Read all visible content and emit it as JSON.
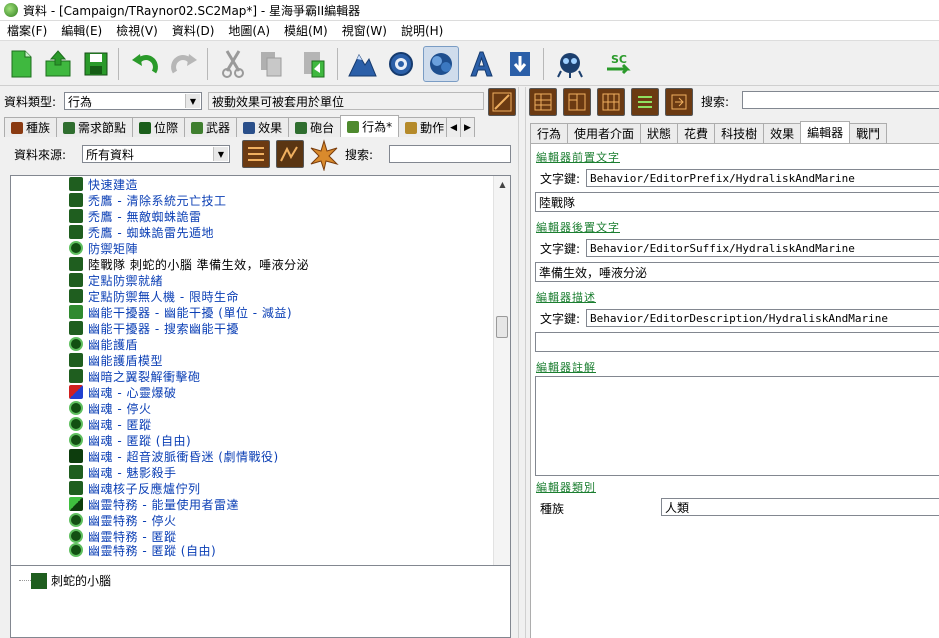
{
  "window": {
    "title": "資料 - [Campaign/TRaynor02.SC2Map*] - 星海爭霸II編輯器"
  },
  "menu": [
    "檔案(F)",
    "編輯(E)",
    "檢視(V)",
    "資料(D)",
    "地圖(A)",
    "模組(M)",
    "視窗(W)",
    "說明(H)"
  ],
  "toolbar": {
    "buttons": [
      "new-file",
      "open-file",
      "save",
      "undo",
      "redo",
      "cut",
      "copy",
      "paste",
      "terrain-editor",
      "trigger-editor",
      "data-editor",
      "text-editor",
      "import-editor",
      "cutscene-editor",
      "script-editor"
    ],
    "pressed": "data-editor"
  },
  "left": {
    "data_type_label": "資料類型:",
    "data_type_value": "行為",
    "data_type_desc": "被動效果可被套用於單位",
    "tabs": [
      "種族",
      "需求節點",
      "位際",
      "武器",
      "效果",
      "砲台",
      "行為*",
      "動作"
    ],
    "active_tab": "行為*",
    "source_label": "資料來源:",
    "source_value": "所有資料",
    "search_label": "搜索:",
    "search_value": "",
    "tree_items": [
      "快速建造",
      "禿鷹 - 清除系統元亡技工",
      "禿鷹 - 無敵蜘蛛詭雷",
      "禿鷹 - 蜘蛛詭雷先遁地",
      "防禦矩陣",
      "陸戰隊 刺蛇的小腦 準備生效，唾液分泌",
      "定點防禦就緒",
      "定點防禦無人機 - 限時生命",
      "幽能干擾器 - 幽能干擾 (單位 - 減益)",
      "幽能干擾器 - 搜索幽能干擾",
      "幽能護盾",
      "幽能護盾模型",
      "幽暗之翼裂解衝擊砲",
      "幽魂 - 心靈爆破",
      "幽魂 - 停火",
      "幽魂 - 匿蹤",
      "幽魂 - 匿蹤 (自由)",
      "幽魂 - 超音波脈衝昏迷 (劇情戰役)",
      "幽魂 - 魅影殺手",
      "幽魂核子反應爐佇列",
      "幽靈特務 - 能量使用者雷達",
      "幽靈特務 - 停火",
      "幽靈特務 - 匿蹤",
      "幽靈特務 - 匿蹤 (自由)"
    ],
    "selected_index": 5,
    "bottom_item": "刺蛇的小腦"
  },
  "right": {
    "search_label": "搜索:",
    "search_value": "",
    "tabs": [
      "行為",
      "使用者介面",
      "狀態",
      "花費",
      "科技樹",
      "效果",
      "編輯器",
      "戰鬥"
    ],
    "active_tab": "編輯器",
    "sections": {
      "prefix_title": "編輯器前置文字",
      "prefix_key_label": "文字鍵:",
      "prefix_key": "Behavior/EditorPrefix/HydraliskAndMarine",
      "prefix_text": "陸戰隊",
      "suffix_title": "編輯器後置文字",
      "suffix_key_label": "文字鍵:",
      "suffix_key": "Behavior/EditorSuffix/HydraliskAndMarine",
      "suffix_text": "準備生效，唾液分泌",
      "desc_title": "編輯器描述",
      "desc_key_label": "文字鍵:",
      "desc_key": "Behavior/EditorDescription/HydraliskAndMarine",
      "desc_text": "",
      "comment_title": "編輯器註解",
      "comment_text": "",
      "category_title": "編輯器類別",
      "race_label": "種族",
      "race_value": "人類"
    }
  },
  "colors": {
    "link_blue": "#0b3fb5",
    "section_green": "#1b7e30"
  }
}
